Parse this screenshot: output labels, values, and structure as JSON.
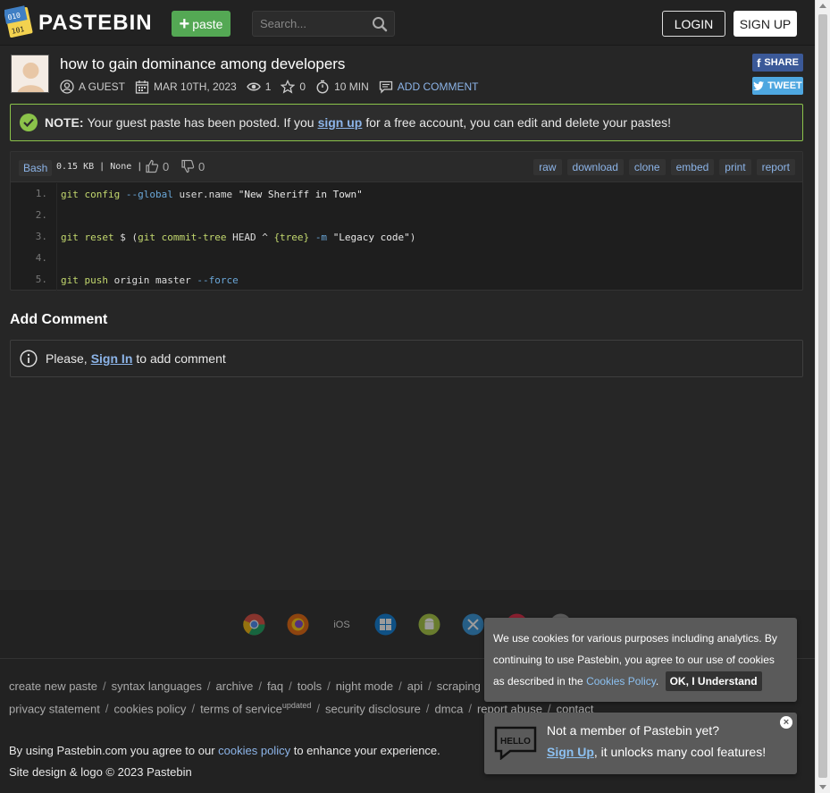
{
  "header": {
    "logo_text": "PASTEBIN",
    "paste_button": "paste",
    "search_placeholder": "Search...",
    "login": "LOGIN",
    "signup": "SIGN UP"
  },
  "paste": {
    "title": "how to gain dominance among developers",
    "author": "A GUEST",
    "date": "MAR 10TH, 2023",
    "views": "1",
    "stars": "0",
    "expire": "10 MIN",
    "add_comment": "ADD COMMENT",
    "share": "SHARE",
    "tweet": "TWEET"
  },
  "notice": {
    "label": "NOTE:",
    "text_before": "Your guest paste has been posted. If you",
    "link": "sign up",
    "text_after": "for a free account, you can edit and delete your pastes!"
  },
  "code": {
    "language": "Bash",
    "size_info": "0.15 KB | None |",
    "likes": "0",
    "dislikes": "0",
    "actions": [
      "raw",
      "download",
      "clone",
      "embed",
      "print",
      "report"
    ],
    "line_numbers": [
      "1.",
      "2.",
      "3.",
      "4.",
      "5."
    ]
  },
  "comments": {
    "title": "Add Comment",
    "prefix": "Please,",
    "link": "Sign In",
    "suffix": "to add comment"
  },
  "footer": {
    "ios_label": "iOS",
    "links_row1": [
      "create new paste",
      "syntax languages",
      "archive",
      "faq",
      "tools",
      "night mode",
      "api",
      "scraping api"
    ],
    "links_row2": [
      "privacy statement",
      "cookies policy",
      "terms of service",
      "security disclosure",
      "dmca",
      "report abuse",
      "contact"
    ],
    "updated_sup": "updated",
    "agree_before": "By using Pastebin.com you agree to our",
    "agree_link": "cookies policy",
    "agree_after": "to enhance your experience.",
    "copyright": "Site design & logo © 2023 Pastebin"
  },
  "cookie_popup": {
    "text": "We use cookies for various purposes including analytics. By continuing to use Pastebin, you agree to our use of cookies as described in the",
    "link": "Cookies Policy",
    "ok": "OK, I Understand"
  },
  "member_popup": {
    "hello_badge": "HELLO",
    "title": "Not a member of Pastebin yet?",
    "link": "Sign Up",
    "text": ", it unlocks many cool features!",
    "close": "×"
  },
  "colors": {
    "accent_green": "#54a854",
    "notice_border": "#8bc34a",
    "link_blue": "#8cb4e8",
    "facebook": "#3b5998",
    "twitter": "#4ea7e0"
  }
}
